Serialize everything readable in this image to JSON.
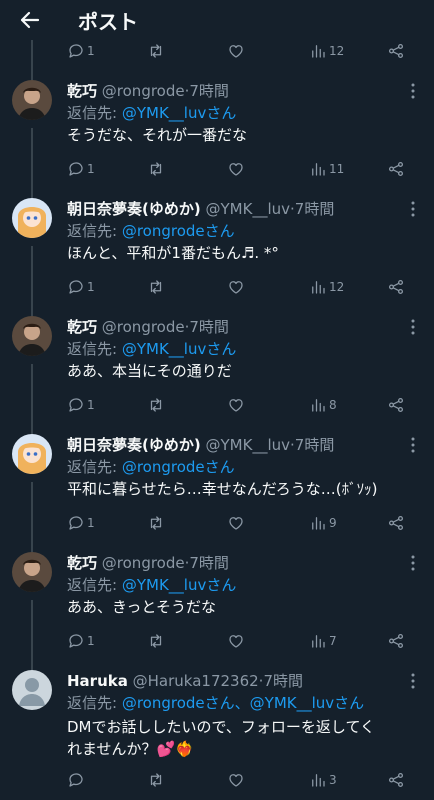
{
  "header": {
    "title": "ポスト"
  },
  "top_actions": {
    "reply": "1",
    "views": "12"
  },
  "tweets": [
    {
      "name": "乾巧",
      "handle": "@rongrode",
      "time": "7時間",
      "reply_label": "返信先:",
      "reply_to": "@YMK__luvさん",
      "text": "そうだな、それが一番だな",
      "replies": "1",
      "views": "11",
      "avatar": "man"
    },
    {
      "name": "朝日奈夢奏(ゆめか)",
      "handle": "@YMK__luv",
      "time": "7時間",
      "reply_label": "返信先:",
      "reply_to": "@rongrodeさん",
      "text": "ほんと、平和が1番だもん♬. *°",
      "replies": "1",
      "views": "12",
      "avatar": "girl"
    },
    {
      "name": "乾巧",
      "handle": "@rongrode",
      "time": "7時間",
      "reply_label": "返信先:",
      "reply_to": "@YMK__luvさん",
      "text": "ああ、本当にその通りだ",
      "replies": "1",
      "views": "8",
      "avatar": "man"
    },
    {
      "name": "朝日奈夢奏(ゆめか)",
      "handle": "@YMK__luv",
      "time": "7時間",
      "reply_label": "返信先:",
      "reply_to": "@rongrodeさん",
      "text": "平和に暮らせたら…幸せなんだろうな…(ﾎﾞｿｯ)",
      "replies": "1",
      "views": "9",
      "avatar": "girl"
    },
    {
      "name": "乾巧",
      "handle": "@rongrode",
      "time": "7時間",
      "reply_label": "返信先:",
      "reply_to": "@YMK__luvさん",
      "text": "ああ、きっとそうだな",
      "replies": "1",
      "views": "7",
      "avatar": "man"
    },
    {
      "name": "Haruka",
      "handle": "@Haruka172362",
      "time": "7時間",
      "reply_label": "返信先:",
      "reply_to": "@rongrodeさん、@YMK__luvさん",
      "text": "DMでお話ししたいので、フォローを返してくれませんか？💕❤️‍🔥",
      "text_line1": "DMでお話ししたいので、フォローを返してく",
      "text_line2": "れませんか？💕❤️‍🔥",
      "replies": "",
      "views": "3",
      "avatar": "default"
    }
  ]
}
